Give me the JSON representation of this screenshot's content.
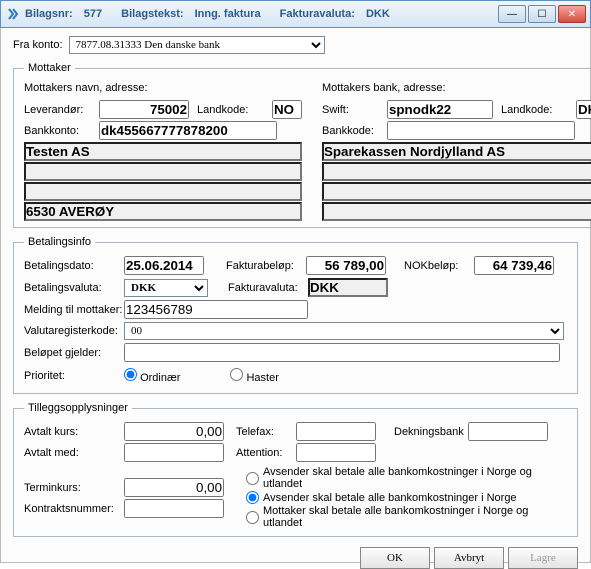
{
  "title": {
    "bilagsnr_label": "Bilagsnr:",
    "bilagsnr": "577",
    "bilagstekst_label": "Bilagstekst:",
    "bilagstekst": "Inng. faktura",
    "fakturavaluta_label": "Fakturavaluta:",
    "fakturavaluta": "DKK"
  },
  "fra_konto": {
    "label": "Fra konto:",
    "value": "7877.08.31333   Den danske bank"
  },
  "mottaker": {
    "legend": "Mottaker",
    "left": {
      "header": "Mottakers navn, adresse:",
      "leverandor_label": "Leverandør:",
      "leverandor": "75002",
      "landkode_label": "Landkode:",
      "landkode": "NO",
      "bankkonto_label": "Bankkonto:",
      "bankkonto": "dk455667777878200",
      "line1": "Testen AS",
      "line2": "",
      "line3": "",
      "line4": "6530 AVERØY"
    },
    "right": {
      "header": "Mottakers bank, adresse:",
      "swift_label": "Swift:",
      "swift": "spnodk22",
      "landkode_label": "Landkode:",
      "landkode": "DK",
      "bankkode_label": "Bankkode:",
      "bankkode": "",
      "line1": "Sparekassen Nordjylland AS",
      "line2": "",
      "line3": "",
      "line4": ""
    }
  },
  "betalingsinfo": {
    "legend": "Betalingsinfo",
    "betalingsdato_label": "Betalingsdato:",
    "betalingsdato": "25.06.2014",
    "fakturabelop_label": "Fakturabeløp:",
    "fakturabelop": "56 789,00",
    "nokbelop_label": "NOKbeløp:",
    "nokbelop": "64 739,46",
    "betalingsvaluta_label": "Betalingsvaluta:",
    "betalingsvaluta": "DKK",
    "fakturavaluta_label": "Fakturavaluta:",
    "fakturavaluta": "DKK",
    "melding_label": "Melding til mottaker:",
    "melding": "123456789",
    "valutaregister_label": "Valutaregisterkode:",
    "valutaregister": "00",
    "belopet_label": "Beløpet gjelder:",
    "belopet": "",
    "prioritet_label": "Prioritet:",
    "prioritet_ordinaer": "Ordinær",
    "prioritet_haster": "Haster"
  },
  "tillegg": {
    "legend": "Tilleggsopplysninger",
    "avtalt_kurs_label": "Avtalt kurs:",
    "avtalt_kurs": "0,00",
    "avtalt_med_label": "Avtalt med:",
    "avtalt_med": "",
    "telefax_label": "Telefax:",
    "telefax": "",
    "attention_label": "Attention:",
    "attention": "",
    "dekningsbank_label": "Dekningsbank",
    "dekningsbank": "",
    "terminkurs_label": "Terminkurs:",
    "terminkurs": "0,00",
    "kontrakt_label": "Kontraktsnummer:",
    "kontrakt": "",
    "radio1": "Avsender skal betale alle bankomkostninger i Norge og utlandet",
    "radio2": "Avsender skal betale alle bankomkostninger i Norge",
    "radio3": "Mottaker  skal betale alle bankomkostninger i Norge og utlandet"
  },
  "buttons": {
    "ok": "OK",
    "avbryt": "Avbryt",
    "lagre": "Lagre"
  }
}
